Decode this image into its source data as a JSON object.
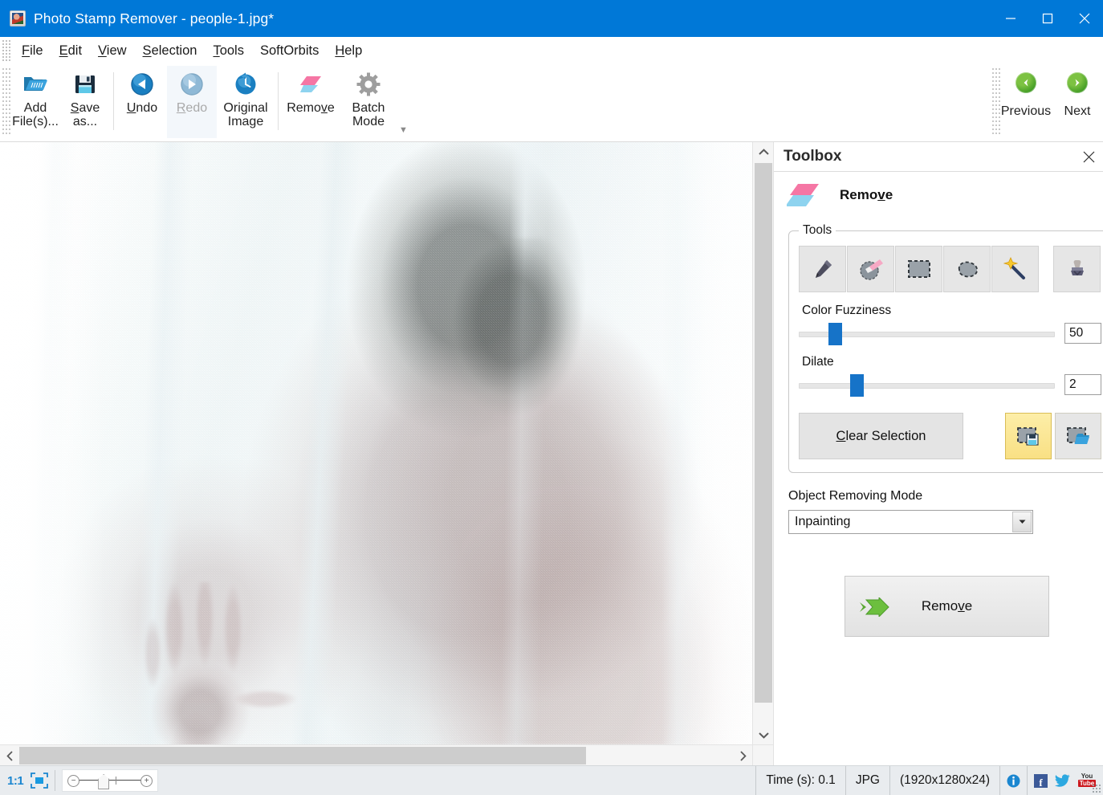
{
  "window": {
    "title": "Photo Stamp Remover - people-1.jpg*",
    "app_icon": "app-photo-icon",
    "minimize_label": "Minimize",
    "maximize_label": "Maximize",
    "close_label": "Close",
    "accent_color": "#0078d7"
  },
  "menubar": {
    "items": [
      {
        "pre": "",
        "accel": "F",
        "post": "ile"
      },
      {
        "pre": "",
        "accel": "E",
        "post": "dit"
      },
      {
        "pre": "",
        "accel": "V",
        "post": "iew"
      },
      {
        "pre": "",
        "accel": "S",
        "post": "election"
      },
      {
        "pre": "",
        "accel": "T",
        "post": "ools"
      },
      {
        "pre": "SoftOrbits",
        "accel": "",
        "post": ""
      },
      {
        "pre": "",
        "accel": "H",
        "post": "elp"
      }
    ]
  },
  "toolbar": {
    "add_files": "Add\nFile(s)...",
    "save_as": "Save\nas...",
    "undo": "Undo",
    "redo": "Redo",
    "original_image": "Original\nImage",
    "remove": "Remove",
    "batch_mode": "Batch\nMode",
    "previous": "Previous",
    "next": "Next",
    "overflow_label": "More commands"
  },
  "toolbox": {
    "panel_title": "Toolbox",
    "close_label": "Close Toolbox",
    "mode_name": "Remove",
    "tools_group_label": "Tools",
    "tools": [
      {
        "name": "marker-tool",
        "title": "Marker"
      },
      {
        "name": "eraser-tool",
        "title": "Eraser"
      },
      {
        "name": "rectangle-select-tool",
        "title": "Rectangle Selection"
      },
      {
        "name": "lasso-select-tool",
        "title": "Lasso Selection"
      },
      {
        "name": "magic-wand-tool",
        "title": "Magic Wand"
      },
      {
        "name": "stamp-tool",
        "title": "Stamp"
      }
    ],
    "color_fuzziness": {
      "label": "Color Fuzziness",
      "value": "50",
      "percent": 12
    },
    "dilate": {
      "label": "Dilate",
      "value": "2",
      "percent": 20
    },
    "clear_selection": {
      "pre": "",
      "accel": "C",
      "post": "lear Selection"
    },
    "save_selection_label": "Save Selection",
    "load_selection_label": "Load Selection",
    "object_removing_mode": {
      "label": "Object Removing Mode",
      "selected": "Inpainting"
    },
    "remove_action": {
      "pre": "Remo",
      "accel": "v",
      "post": "e"
    }
  },
  "statusbar": {
    "zoom_ratio": "1:1",
    "fit_label": "Fit to window",
    "time": "Time (s): 0.1",
    "format": "JPG",
    "dimensions": "(1920x1280x24)",
    "info_label": "Info",
    "facebook": "f",
    "youtube_top": "You",
    "youtube_bottom": "Tube",
    "twitter_label": "Twitter"
  },
  "canvas": {
    "image_name": "people-1.jpg",
    "description": "Silhouette of a person with an open hand pressed behind a sheer white curtain"
  }
}
